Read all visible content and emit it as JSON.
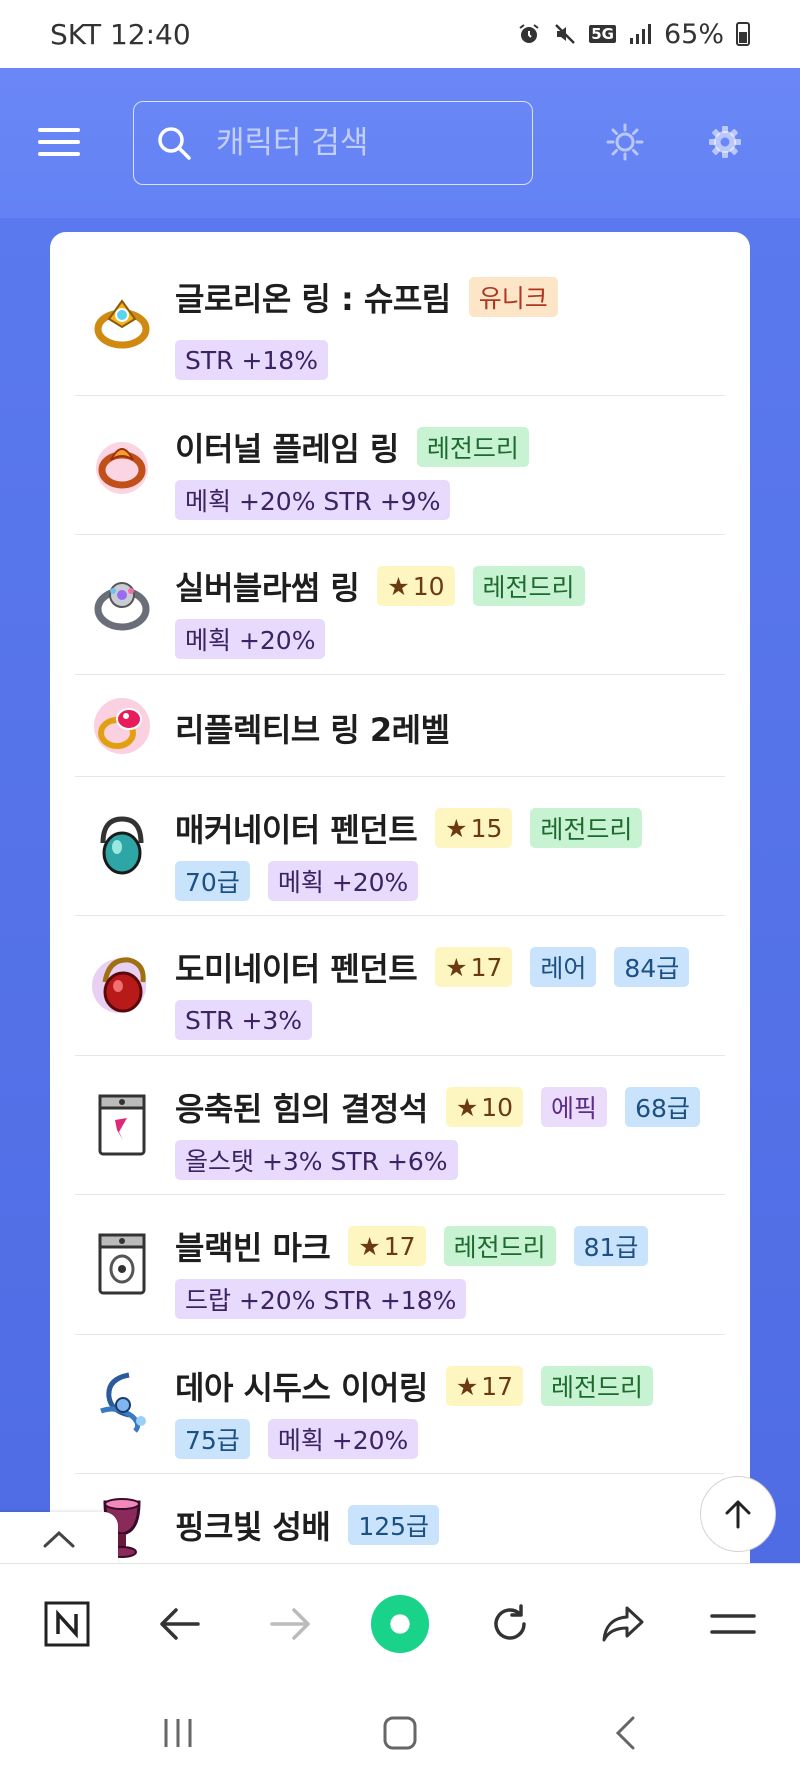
{
  "status_bar": {
    "carrier_time": "SKT 12:40",
    "network": "5G",
    "battery": "65%"
  },
  "header": {
    "search_placeholder": "캐릭터 검색"
  },
  "items": [
    {
      "name": "글로리온 링 : 슈프림",
      "badges": [
        {
          "text": "유니크",
          "kind": "unique"
        }
      ],
      "stats": [
        "STR +18%"
      ]
    },
    {
      "name": "이터널 플레임 링",
      "badges": [
        {
          "text": "레전드리",
          "kind": "legend"
        }
      ],
      "stats": [
        "메획 +20% STR +9%"
      ]
    },
    {
      "name": "실버블라썸 링",
      "badges": [
        {
          "text": "10",
          "kind": "star"
        },
        {
          "text": "레전드리",
          "kind": "legend"
        }
      ],
      "stats": [
        "메획 +20%"
      ]
    },
    {
      "name": "리플렉티브 링 2레벨",
      "badges": [],
      "stats": []
    },
    {
      "name": "매커네이터 펜던트",
      "badges": [
        {
          "text": "15",
          "kind": "star"
        },
        {
          "text": "레전드리",
          "kind": "legend"
        }
      ],
      "stats": [
        "70급",
        "메획 +20%"
      ]
    },
    {
      "name": "도미네이터 펜던트",
      "badges": [
        {
          "text": "17",
          "kind": "star"
        },
        {
          "text": "레어",
          "kind": "rare"
        },
        {
          "text": "84급",
          "kind": "level"
        }
      ],
      "stats": [
        "STR +3%"
      ]
    },
    {
      "name": "응축된 힘의 결정석",
      "badges": [
        {
          "text": "10",
          "kind": "star"
        },
        {
          "text": "에픽",
          "kind": "epic"
        },
        {
          "text": "68급",
          "kind": "level"
        }
      ],
      "stats": [
        "올스탯 +3% STR +6%"
      ]
    },
    {
      "name": "블랙빈 마크",
      "badges": [
        {
          "text": "17",
          "kind": "star"
        },
        {
          "text": "레전드리",
          "kind": "legend"
        },
        {
          "text": "81급",
          "kind": "level"
        }
      ],
      "stats": [
        "드랍 +20% STR +18%"
      ]
    },
    {
      "name": "데아 시두스 이어링",
      "badges": [
        {
          "text": "17",
          "kind": "star"
        },
        {
          "text": "레전드리",
          "kind": "legend"
        }
      ],
      "stats": [
        "75급",
        "메획 +20%"
      ]
    },
    {
      "name": "핑크빛 성배",
      "badges": [
        {
          "text": "125급",
          "kind": "level"
        }
      ],
      "stats": []
    }
  ],
  "icons": {
    "menu": "hamburger-icon",
    "search": "search-icon",
    "theme": "sun-icon",
    "settings": "gear-icon",
    "scroll_top": "arrow-up-icon",
    "collapse": "chevron-up-icon",
    "browser": [
      "naver-home-icon",
      "back-arrow-icon",
      "forward-arrow-icon",
      "green-circle-icon",
      "refresh-icon",
      "share-icon",
      "menu-lines-icon"
    ],
    "system": [
      "recent-apps-icon",
      "home-icon",
      "back-icon"
    ]
  },
  "colors": {
    "header": "#6b87f7",
    "content_bg": "#5170e6",
    "accent_green": "#19d38a"
  }
}
